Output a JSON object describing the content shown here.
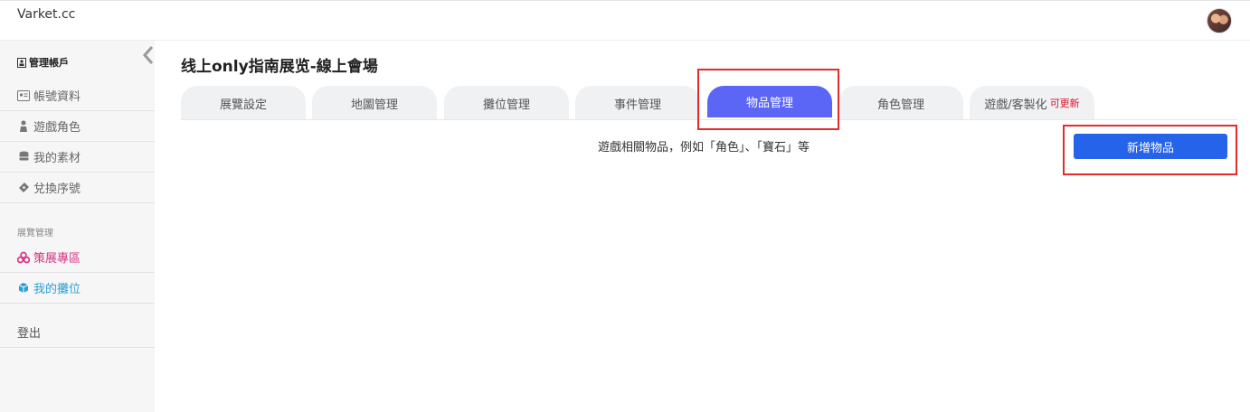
{
  "app": {
    "brand": "Varket.cc"
  },
  "sidebar": {
    "account_header": "管理帳戶",
    "account_items": [
      {
        "label": "帳號資料",
        "icon": "id-card-icon"
      },
      {
        "label": "遊戲角色",
        "icon": "person-icon"
      },
      {
        "label": "我的素材",
        "icon": "database-icon"
      },
      {
        "label": "兌換序號",
        "icon": "ticket-icon"
      }
    ],
    "exhibit_header": "展覽管理",
    "exhibit_items": [
      {
        "label": "策展專區",
        "icon": "cubes-icon",
        "color": "#d63384"
      },
      {
        "label": "我的攤位",
        "icon": "cube-icon",
        "color": "#2a9fd6"
      }
    ],
    "logout": "登出"
  },
  "main": {
    "title": "线上only指南展览-線上會場",
    "tabs": [
      {
        "label": "展覽設定"
      },
      {
        "label": "地圖管理"
      },
      {
        "label": "攤位管理"
      },
      {
        "label": "事件管理"
      },
      {
        "label": "物品管理",
        "active": true
      },
      {
        "label": "角色管理"
      },
      {
        "label": "遊戲/客製化",
        "badge": "可更新"
      }
    ],
    "hint": "遊戲相關物品，例如「角色」、「寶石」等",
    "add_button": "新增物品"
  },
  "colors": {
    "accent": "#5b66f6",
    "primary_button": "#2563eb",
    "highlight": "#e32b2b",
    "update_badge": "#e0102a"
  }
}
